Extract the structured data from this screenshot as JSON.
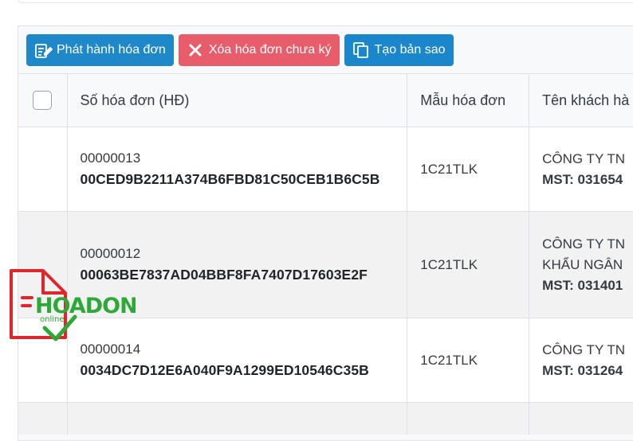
{
  "toolbar": {
    "issue_label": "Phát hành hóa đơn",
    "delete_label": "Xóa hóa đơn chưa ký",
    "copy_label": "Tạo bản sao"
  },
  "table": {
    "headers": [
      "Số hóa đơn (HĐ)",
      "Mẫu hóa đơn",
      "Tên khách hà"
    ],
    "rows": [
      {
        "number": "00000013",
        "code": "00CED9B2211A374B6FBD81C50CEB1B6C5B",
        "template": "1C21TLK",
        "customer_line1": "CÔNG TY TN",
        "customer_line2": "",
        "tax": "MST: 031654"
      },
      {
        "number": "00000012",
        "code": "00063BE7837AD04BBF8FA7407D17603E2F",
        "template": "1C21TLK",
        "customer_line1": "CÔNG TY TN",
        "customer_line2": "KHẨU NGÂN",
        "tax": "MST: 031401"
      },
      {
        "number": "00000014",
        "code": "0034DC7D12E6A040F9A1299ED10546C35B",
        "template": "1C21TLK",
        "customer_line1": "CÔNG TY TN",
        "customer_line2": "",
        "tax": "MST: 031264"
      }
    ]
  },
  "watermark": {
    "text": "HOADON",
    "subtext": "online",
    "colors": {
      "red": "#e0262b",
      "green": "#2ea836"
    }
  }
}
